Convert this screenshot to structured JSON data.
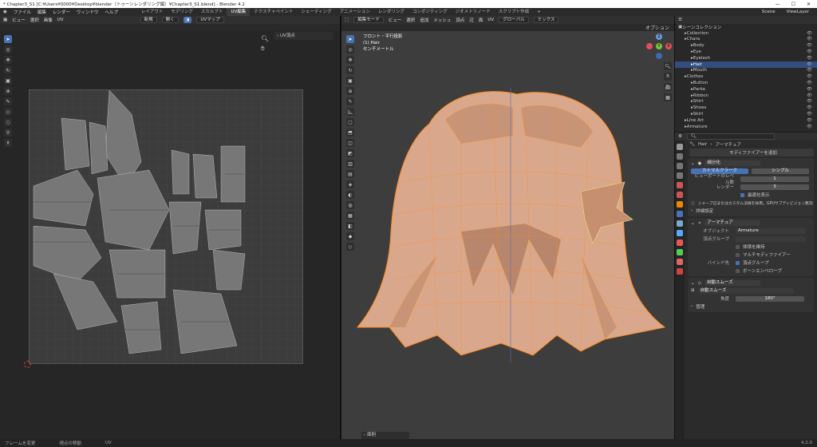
{
  "window": {
    "title": "* Chapter3_S1 [C:¥Users¥0000¥Desktop¥blender（トゥーンレンダリング編）¥Chapter3_S1.blend] - Blender 4.2",
    "controls": [
      "—",
      "☐",
      "✕"
    ]
  },
  "menu": {
    "items": [
      "ファイル",
      "編集",
      "レンダー",
      "ウィンドウ",
      "ヘルプ"
    ],
    "workspaces": [
      "レイアウト",
      "モデリング",
      "スカルプト",
      "UV編集",
      "テクスチャペイント",
      "シェーディング",
      "アニメーション",
      "レンダリング",
      "コンポジティング",
      "ジオメトリノード",
      "スクリプト作成",
      "+"
    ],
    "active_workspace": "UV編集",
    "scene": "Scene",
    "view_layer": "ViewLayer"
  },
  "uv_editor": {
    "menus": [
      "ビュー",
      "選択",
      "画像",
      "UV"
    ],
    "new_button": "新規",
    "open_button": "開く",
    "uvmap": "UVマップ",
    "panel_label": "UV頂点"
  },
  "viewport": {
    "mode": "編集モード",
    "menus": [
      "ビュー",
      "選択",
      "追加",
      "メッシュ",
      "頂点",
      "辺",
      "面",
      "UV"
    ],
    "transform": "グローバル",
    "pivot": "ミックス",
    "options": "オプション",
    "info_lines": [
      "フロント・平行投影",
      "(1) Hair",
      "センチメートル"
    ],
    "bottom_panel": "面削",
    "axes": [
      "X",
      "Y",
      "Z"
    ]
  },
  "outliner": {
    "title": "シーンコレクション",
    "rows": [
      {
        "indent": 1,
        "label": "Collection",
        "sel": false
      },
      {
        "indent": 1,
        "label": "Chara",
        "sel": false
      },
      {
        "indent": 2,
        "label": "Body",
        "sel": false
      },
      {
        "indent": 2,
        "label": "Eye",
        "sel": false
      },
      {
        "indent": 2,
        "label": "Eyelash",
        "sel": false
      },
      {
        "indent": 2,
        "label": "Hair",
        "sel": true
      },
      {
        "indent": 2,
        "label": "Mouth",
        "sel": false
      },
      {
        "indent": 1,
        "label": "Clothes",
        "sel": false
      },
      {
        "indent": 2,
        "label": "Button",
        "sel": false
      },
      {
        "indent": 2,
        "label": "Parka",
        "sel": false
      },
      {
        "indent": 2,
        "label": "Ribbon",
        "sel": false
      },
      {
        "indent": 2,
        "label": "Shirt",
        "sel": false
      },
      {
        "indent": 2,
        "label": "Shoes",
        "sel": false
      },
      {
        "indent": 2,
        "label": "Skirt",
        "sel": false
      },
      {
        "indent": 1,
        "label": "Line Art",
        "sel": false
      },
      {
        "indent": 1,
        "label": "Armature",
        "sel": false
      }
    ]
  },
  "properties": {
    "breadcrumb_obj": "Hair",
    "breadcrumb_mod": "アーマチュア",
    "add_modifier": "モディファイアーを追加",
    "subsurf": {
      "name": "細分化",
      "mode_catmull": "カトマルクラーク",
      "mode_simple": "シンプル",
      "viewport_label": "ビューポートのレベル数",
      "viewport_value": "1",
      "render_label": "レンダー",
      "render_value": "3",
      "optimal": "最適化表示",
      "note": "シャープ辺またはカスタム法線を採用。GPUサブディビジョン無効",
      "advanced": "詳細設定"
    },
    "armature": {
      "name": "アーマチュア",
      "object_label": "オブジェクト",
      "object_value": "Armature",
      "vgroup_label": "頂点グループ",
      "preserve_volume": "体積を維持",
      "multi_modifier": "マルチモディファイアー",
      "bind_label": "バインド先",
      "bind_vgroup": "頂点グループ",
      "bind_envelope": "ボーンエンベロープ"
    },
    "autosmooth": {
      "name": "自動スムーズ",
      "inner_name": "自動スムーズ",
      "angle_label": "角度",
      "angle_value": "180°",
      "manage": "管理"
    }
  },
  "status": {
    "items": [
      "フレームを変更",
      "視点の移動",
      "UV"
    ],
    "version": "4.2.0"
  },
  "colors": {
    "mesh_fill": "#d9a88c",
    "mesh_edge": "#ff8a1e",
    "selection": "#4772b3"
  }
}
